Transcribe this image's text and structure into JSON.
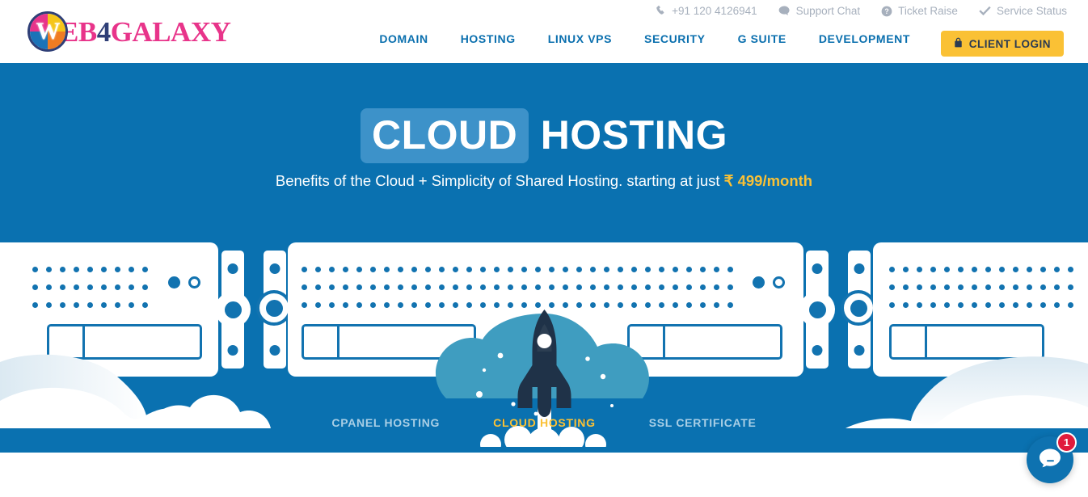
{
  "brand": {
    "logo_prefix": "EB",
    "logo_four": "4",
    "logo_suffix": "GALAXY",
    "logo_mark_letter": "W",
    "accent_blue": "#0a71b0",
    "accent_yellow": "#fac135",
    "accent_pink": "#e8348a",
    "accent_navy": "#2f3f77"
  },
  "header": {
    "utility": [
      {
        "icon": "phone-icon",
        "label": "+91 120 4126941"
      },
      {
        "icon": "chat-bubble-icon",
        "label": "Support Chat"
      },
      {
        "icon": "question-circle-icon",
        "label": "Ticket Raise"
      },
      {
        "icon": "check-icon",
        "label": "Service Status"
      }
    ],
    "nav": [
      {
        "label": "DOMAIN"
      },
      {
        "label": "HOSTING"
      },
      {
        "label": "LINUX VPS"
      },
      {
        "label": "SECURITY"
      },
      {
        "label": "G SUITE"
      },
      {
        "label": "DEVELOPMENT"
      }
    ],
    "client_login": {
      "icon": "lock-icon",
      "label": "CLIENT LOGIN"
    }
  },
  "hero": {
    "title_highlight": "CLOUD",
    "title_rest": "HOSTING",
    "subtitle_line1": "Benefits of the Cloud + Simplicity of Shared Hosting. starting at just",
    "subtitle_price": "₹ 499/month",
    "illustration": "server-rack-rocket-launch"
  },
  "tabs": [
    {
      "label": "CPANEL HOSTING",
      "active": false
    },
    {
      "label": "CLOUD HOSTING",
      "active": true
    },
    {
      "label": "SSL CERTIFICATE",
      "active": false
    }
  ],
  "chat_widget": {
    "icon": "chat-bubble-icon",
    "unread_count": "1"
  }
}
